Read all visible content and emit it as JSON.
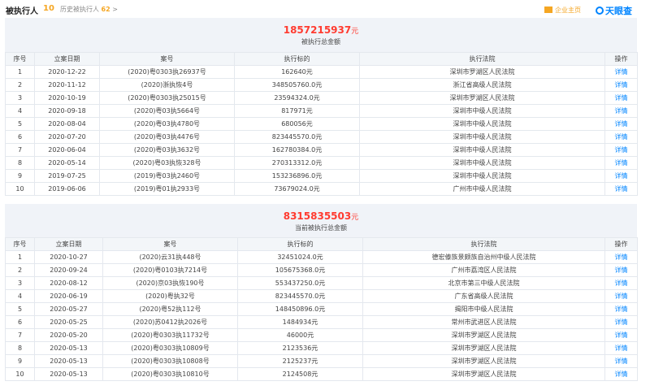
{
  "header": {
    "title": "被执行人",
    "count": "10",
    "history_label": "历史被执行人",
    "history_count": "62",
    "history_chevron": ">",
    "enterprise_label": "企业主页",
    "brand": "天眼查"
  },
  "section1": {
    "amount": "1857215937",
    "unit": "元",
    "label": "被执行总金额",
    "headers": [
      "序号",
      "立案日期",
      "案号",
      "执行标的",
      "执行法院",
      "操作"
    ],
    "rows": [
      [
        "1",
        "2020-12-22",
        "(2020)粤0303执26937号",
        "162640元",
        "深圳市罗湖区人民法院",
        "详情"
      ],
      [
        "2",
        "2020-11-12",
        "(2020)浙执恢4号",
        "348505760.0元",
        "浙江省高级人民法院",
        "详情"
      ],
      [
        "3",
        "2020-10-19",
        "(2020)粤0303执25015号",
        "23594324.0元",
        "深圳市罗湖区人民法院",
        "详情"
      ],
      [
        "4",
        "2020-09-18",
        "(2020)粤03执5664号",
        "817971元",
        "深圳市中级人民法院",
        "详情"
      ],
      [
        "5",
        "2020-08-04",
        "(2020)粤03执4780号",
        "680056元",
        "深圳市中级人民法院",
        "详情"
      ],
      [
        "6",
        "2020-07-20",
        "(2020)粤03执4476号",
        "823445570.0元",
        "深圳市中级人民法院",
        "详情"
      ],
      [
        "7",
        "2020-06-04",
        "(2020)粤03执3632号",
        "162780384.0元",
        "深圳市中级人民法院",
        "详情"
      ],
      [
        "8",
        "2020-05-14",
        "(2020)粤03执恢328号",
        "270313312.0元",
        "深圳市中级人民法院",
        "详情"
      ],
      [
        "9",
        "2019-07-25",
        "(2019)粤03执2460号",
        "153236896.0元",
        "深圳市中级人民法院",
        "详情"
      ],
      [
        "10",
        "2019-06-06",
        "(2019)粤01执2933号",
        "73679024.0元",
        "广州市中级人民法院",
        "详情"
      ]
    ]
  },
  "section2": {
    "amount": "8315835503",
    "unit": "元",
    "label": "当前被执行总金额",
    "headers": [
      "序号",
      "立案日期",
      "案号",
      "执行标的",
      "执行法院",
      "操作"
    ],
    "rows": [
      [
        "1",
        "2020-10-27",
        "(2020)云31执448号",
        "32451024.0元",
        "德宏傣族景颇族自治州中级人民法院",
        "详情"
      ],
      [
        "2",
        "2020-09-24",
        "(2020)粤0103执7214号",
        "105675368.0元",
        "广州市荔湾区人民法院",
        "详情"
      ],
      [
        "3",
        "2020-08-12",
        "(2020)京03执恢190号",
        "553437250.0元",
        "北京市第三中级人民法院",
        "详情"
      ],
      [
        "4",
        "2020-06-19",
        "(2020)粤执32号",
        "823445570.0元",
        "广东省高级人民法院",
        "详情"
      ],
      [
        "5",
        "2020-05-27",
        "(2020)粤52执112号",
        "148450896.0元",
        "揭阳市中级人民法院",
        "详情"
      ],
      [
        "6",
        "2020-05-25",
        "(2020)苏0412执2026号",
        "1484934元",
        "常州市武进区人民法院",
        "详情"
      ],
      [
        "7",
        "2020-05-20",
        "(2020)粤0303执11732号",
        "46000元",
        "深圳市罗湖区人民法院",
        "详情"
      ],
      [
        "8",
        "2020-05-13",
        "(2020)粤0303执10809号",
        "2123536元",
        "深圳市罗湖区人民法院",
        "详情"
      ],
      [
        "9",
        "2020-05-13",
        "(2020)粤0303执10808号",
        "2125237元",
        "深圳市罗湖区人民法院",
        "详情"
      ],
      [
        "10",
        "2020-05-13",
        "(2020)粤0303执10810号",
        "2124508元",
        "深圳市罗湖区人民法院",
        "详情"
      ]
    ]
  }
}
